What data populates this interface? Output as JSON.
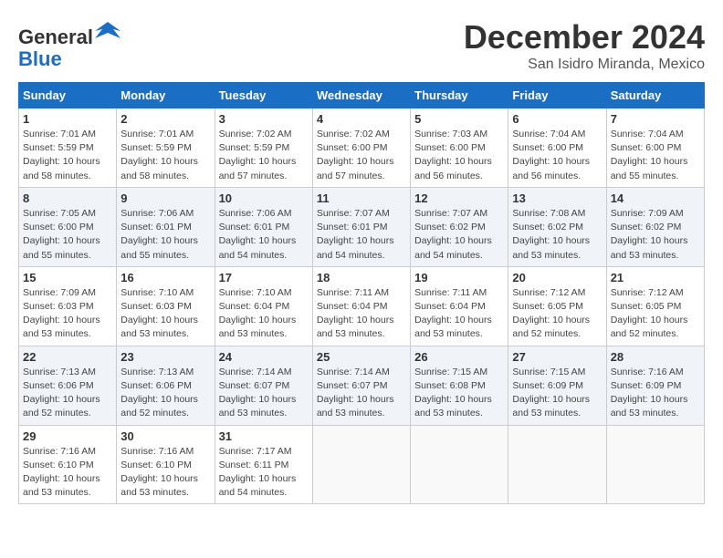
{
  "header": {
    "logo_general": "General",
    "logo_blue": "Blue",
    "month_title": "December 2024",
    "location": "San Isidro Miranda, Mexico"
  },
  "days_of_week": [
    "Sunday",
    "Monday",
    "Tuesday",
    "Wednesday",
    "Thursday",
    "Friday",
    "Saturday"
  ],
  "weeks": [
    [
      {
        "day": "1",
        "sunrise": "7:01 AM",
        "sunset": "5:59 PM",
        "daylight": "10 hours and 58 minutes."
      },
      {
        "day": "2",
        "sunrise": "7:01 AM",
        "sunset": "5:59 PM",
        "daylight": "10 hours and 58 minutes."
      },
      {
        "day": "3",
        "sunrise": "7:02 AM",
        "sunset": "5:59 PM",
        "daylight": "10 hours and 57 minutes."
      },
      {
        "day": "4",
        "sunrise": "7:02 AM",
        "sunset": "6:00 PM",
        "daylight": "10 hours and 57 minutes."
      },
      {
        "day": "5",
        "sunrise": "7:03 AM",
        "sunset": "6:00 PM",
        "daylight": "10 hours and 56 minutes."
      },
      {
        "day": "6",
        "sunrise": "7:04 AM",
        "sunset": "6:00 PM",
        "daylight": "10 hours and 56 minutes."
      },
      {
        "day": "7",
        "sunrise": "7:04 AM",
        "sunset": "6:00 PM",
        "daylight": "10 hours and 55 minutes."
      }
    ],
    [
      {
        "day": "8",
        "sunrise": "7:05 AM",
        "sunset": "6:00 PM",
        "daylight": "10 hours and 55 minutes."
      },
      {
        "day": "9",
        "sunrise": "7:06 AM",
        "sunset": "6:01 PM",
        "daylight": "10 hours and 55 minutes."
      },
      {
        "day": "10",
        "sunrise": "7:06 AM",
        "sunset": "6:01 PM",
        "daylight": "10 hours and 54 minutes."
      },
      {
        "day": "11",
        "sunrise": "7:07 AM",
        "sunset": "6:01 PM",
        "daylight": "10 hours and 54 minutes."
      },
      {
        "day": "12",
        "sunrise": "7:07 AM",
        "sunset": "6:02 PM",
        "daylight": "10 hours and 54 minutes."
      },
      {
        "day": "13",
        "sunrise": "7:08 AM",
        "sunset": "6:02 PM",
        "daylight": "10 hours and 53 minutes."
      },
      {
        "day": "14",
        "sunrise": "7:09 AM",
        "sunset": "6:02 PM",
        "daylight": "10 hours and 53 minutes."
      }
    ],
    [
      {
        "day": "15",
        "sunrise": "7:09 AM",
        "sunset": "6:03 PM",
        "daylight": "10 hours and 53 minutes."
      },
      {
        "day": "16",
        "sunrise": "7:10 AM",
        "sunset": "6:03 PM",
        "daylight": "10 hours and 53 minutes."
      },
      {
        "day": "17",
        "sunrise": "7:10 AM",
        "sunset": "6:04 PM",
        "daylight": "10 hours and 53 minutes."
      },
      {
        "day": "18",
        "sunrise": "7:11 AM",
        "sunset": "6:04 PM",
        "daylight": "10 hours and 53 minutes."
      },
      {
        "day": "19",
        "sunrise": "7:11 AM",
        "sunset": "6:04 PM",
        "daylight": "10 hours and 53 minutes."
      },
      {
        "day": "20",
        "sunrise": "7:12 AM",
        "sunset": "6:05 PM",
        "daylight": "10 hours and 52 minutes."
      },
      {
        "day": "21",
        "sunrise": "7:12 AM",
        "sunset": "6:05 PM",
        "daylight": "10 hours and 52 minutes."
      }
    ],
    [
      {
        "day": "22",
        "sunrise": "7:13 AM",
        "sunset": "6:06 PM",
        "daylight": "10 hours and 52 minutes."
      },
      {
        "day": "23",
        "sunrise": "7:13 AM",
        "sunset": "6:06 PM",
        "daylight": "10 hours and 52 minutes."
      },
      {
        "day": "24",
        "sunrise": "7:14 AM",
        "sunset": "6:07 PM",
        "daylight": "10 hours and 53 minutes."
      },
      {
        "day": "25",
        "sunrise": "7:14 AM",
        "sunset": "6:07 PM",
        "daylight": "10 hours and 53 minutes."
      },
      {
        "day": "26",
        "sunrise": "7:15 AM",
        "sunset": "6:08 PM",
        "daylight": "10 hours and 53 minutes."
      },
      {
        "day": "27",
        "sunrise": "7:15 AM",
        "sunset": "6:09 PM",
        "daylight": "10 hours and 53 minutes."
      },
      {
        "day": "28",
        "sunrise": "7:16 AM",
        "sunset": "6:09 PM",
        "daylight": "10 hours and 53 minutes."
      }
    ],
    [
      {
        "day": "29",
        "sunrise": "7:16 AM",
        "sunset": "6:10 PM",
        "daylight": "10 hours and 53 minutes."
      },
      {
        "day": "30",
        "sunrise": "7:16 AM",
        "sunset": "6:10 PM",
        "daylight": "10 hours and 53 minutes."
      },
      {
        "day": "31",
        "sunrise": "7:17 AM",
        "sunset": "6:11 PM",
        "daylight": "10 hours and 54 minutes."
      },
      null,
      null,
      null,
      null
    ]
  ]
}
